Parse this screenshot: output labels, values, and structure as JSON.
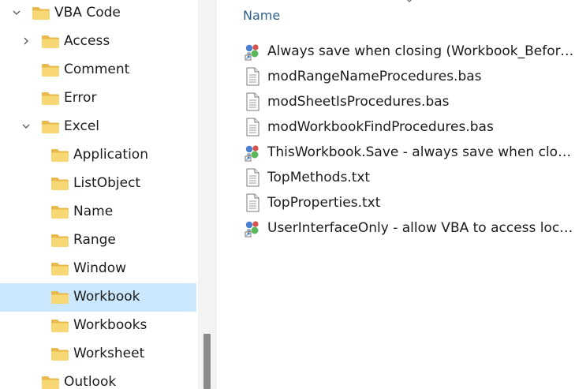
{
  "nav": {
    "items": [
      {
        "label": "VBA Code",
        "level": 0,
        "expanded": true,
        "hasChildren": true
      },
      {
        "label": "Access",
        "level": 1,
        "expanded": false,
        "hasChildren": true
      },
      {
        "label": "Comment",
        "level": 1,
        "expanded": false,
        "hasChildren": false
      },
      {
        "label": "Error",
        "level": 1,
        "expanded": false,
        "hasChildren": false
      },
      {
        "label": "Excel",
        "level": 1,
        "expanded": true,
        "hasChildren": true
      },
      {
        "label": "Application",
        "level": 2,
        "expanded": false,
        "hasChildren": false
      },
      {
        "label": "ListObject",
        "level": 2,
        "expanded": false,
        "hasChildren": false
      },
      {
        "label": "Name",
        "level": 2,
        "expanded": false,
        "hasChildren": false
      },
      {
        "label": "Range",
        "level": 2,
        "expanded": false,
        "hasChildren": false
      },
      {
        "label": "Window",
        "level": 2,
        "expanded": false,
        "hasChildren": false
      },
      {
        "label": "Workbook",
        "level": 2,
        "expanded": false,
        "hasChildren": false,
        "selected": true
      },
      {
        "label": "Workbooks",
        "level": 2,
        "expanded": false,
        "hasChildren": false
      },
      {
        "label": "Worksheet",
        "level": 2,
        "expanded": false,
        "hasChildren": false
      },
      {
        "label": "Outlook",
        "level": 1,
        "expanded": false,
        "hasChildren": false
      }
    ]
  },
  "content": {
    "column_name": "Name",
    "files": [
      {
        "label": "Always save when closing (Workbook_BeforeCl...",
        "icon": "shortcut-icon"
      },
      {
        "label": "modRangeNameProcedures.bas",
        "icon": "document-icon"
      },
      {
        "label": "modSheetIsProcedures.bas",
        "icon": "document-icon"
      },
      {
        "label": "modWorkbookFindProcedures.bas",
        "icon": "document-icon"
      },
      {
        "label": "ThisWorkbook.Save - always save when closing ...",
        "icon": "shortcut-icon"
      },
      {
        "label": "TopMethods.txt",
        "icon": "document-icon"
      },
      {
        "label": "TopProperties.txt",
        "icon": "document-icon"
      },
      {
        "label": "UserInterfaceOnly - allow VBA to access locked ...",
        "icon": "shortcut-icon"
      }
    ]
  },
  "colors": {
    "selection": "#cce8ff",
    "folder": "#f8d775",
    "folder_dark": "#e8b84a",
    "header_text": "#2f5f8a"
  }
}
